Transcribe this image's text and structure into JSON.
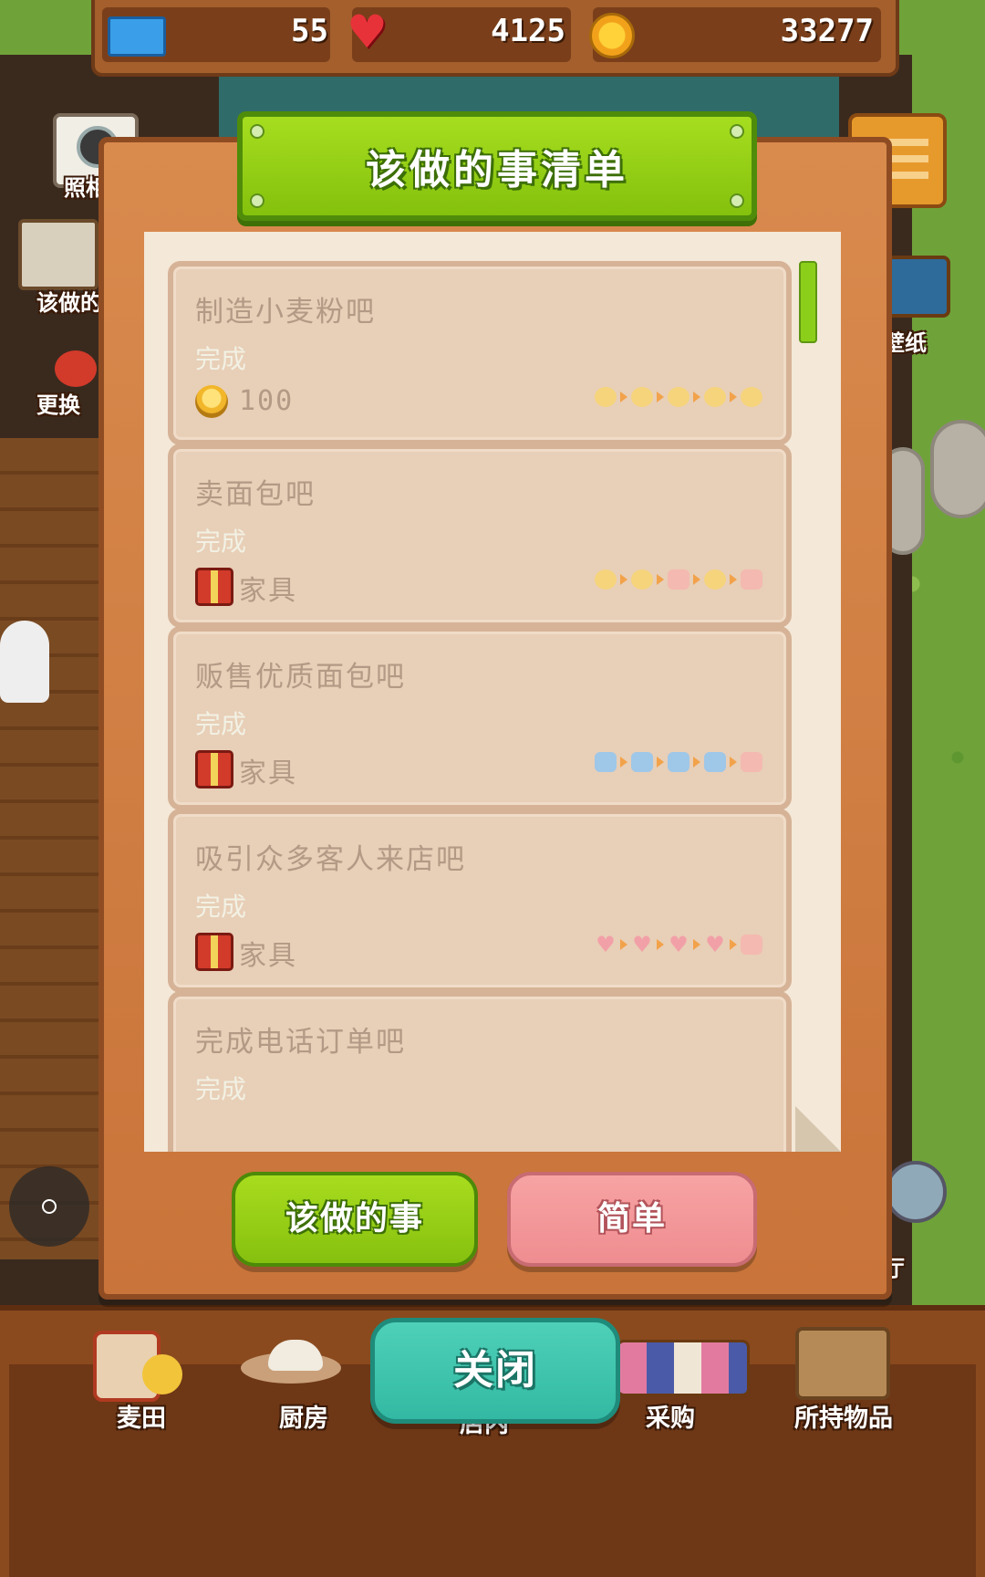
{
  "hud": {
    "tickets": "55",
    "hearts": "4125",
    "coins": "33277"
  },
  "side_buttons": {
    "camera_label": "照相",
    "todo_label": "该做的",
    "change_label": "更换",
    "wallpaper_label": "壁纸",
    "hall_label": "厅"
  },
  "dialog": {
    "title": "该做的事清单",
    "tasks": [
      {
        "title": "制造小麦粉吧",
        "status": "完成",
        "reward": "100",
        "reward_icon": "coin-stack-icon"
      },
      {
        "title": "卖面包吧",
        "status": "完成",
        "reward": "家具",
        "reward_icon": "gift-icon"
      },
      {
        "title": "贩售优质面包吧",
        "status": "完成",
        "reward": "家具",
        "reward_icon": "gift-icon"
      },
      {
        "title": "吸引众多客人来店吧",
        "status": "完成",
        "reward": "家具",
        "reward_icon": "gift-icon"
      },
      {
        "title": "完成电话订单吧",
        "status": "完成",
        "reward": "",
        "reward_icon": ""
      }
    ],
    "buttons": {
      "todo": "该做的事",
      "easy": "简单",
      "close": "关闭"
    }
  },
  "bottom_nav": {
    "items": [
      {
        "label": "麦田",
        "icon": "wheat-field-icon"
      },
      {
        "label": "厨房",
        "icon": "kitchen-icon"
      },
      {
        "label": "店内",
        "icon": "shop-icon"
      },
      {
        "label": "采购",
        "icon": "purchase-icon"
      },
      {
        "label": "所持物品",
        "icon": "inventory-box-icon"
      }
    ]
  },
  "colors": {
    "dialog_wood": "#d98a4d",
    "title_green": "#8ccf14",
    "paper": "#f4e8d8",
    "task_card": "#e8cfb7",
    "close_teal": "#3ec4ad",
    "easy_pink": "#f29a9c"
  }
}
